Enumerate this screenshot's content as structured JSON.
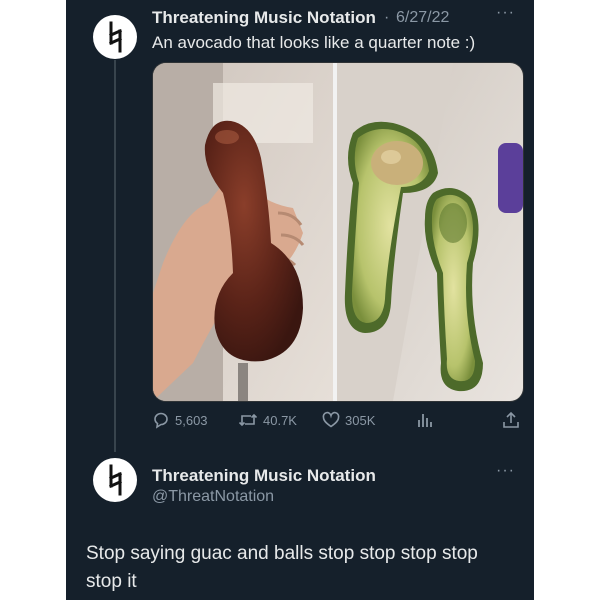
{
  "tweet": {
    "author": "Threatening Music Notation",
    "separator": "·",
    "date": "6/27/22",
    "more": "···",
    "text": "An avocado that looks like a quarter note :)",
    "stats": {
      "replies": "5,603",
      "retweets": "40.7K",
      "likes": "305K"
    }
  },
  "reply": {
    "author": "Threatening Music Notation",
    "handle": "@ThreatNotation",
    "more": "···",
    "text": "Stop saying guac and balls stop stop stop stop stop it"
  },
  "colors": {
    "background": "#15202b",
    "text": "#e7e9ea",
    "muted": "#8b98a5"
  },
  "icons": {
    "avatar": "natural-sign-icon",
    "reply": "speech-bubble-icon",
    "retweet": "retweet-icon",
    "like": "heart-icon",
    "views": "bar-chart-icon",
    "share": "share-icon"
  }
}
